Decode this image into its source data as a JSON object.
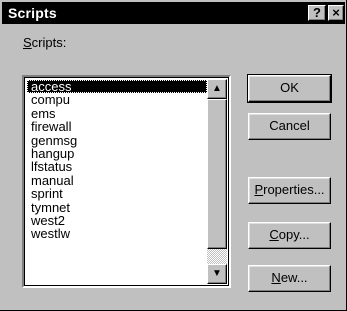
{
  "window": {
    "title": "Scripts",
    "help_glyph": "?",
    "close_glyph": "×"
  },
  "list": {
    "label_mnemonic": "S",
    "label_rest": "cripts:",
    "items": [
      "access",
      "compu",
      "ems",
      "firewall",
      "genmsg",
      "hangup",
      "lfstatus",
      "manual",
      "sprint",
      "tymnet",
      "west2",
      "westlw"
    ],
    "selected": "access",
    "scroll_up_icon": "▲",
    "scroll_down_icon": "▼"
  },
  "buttons": {
    "ok": "OK",
    "cancel": "Cancel",
    "properties_mnemonic": "P",
    "properties_rest": "roperties...",
    "copy_mnemonic": "C",
    "copy_rest": "opy...",
    "new_mnemonic": "N",
    "new_rest": "ew..."
  },
  "colors": {
    "titlebar": "#000000",
    "face": "#c0c0c0",
    "selection": "#000000"
  }
}
